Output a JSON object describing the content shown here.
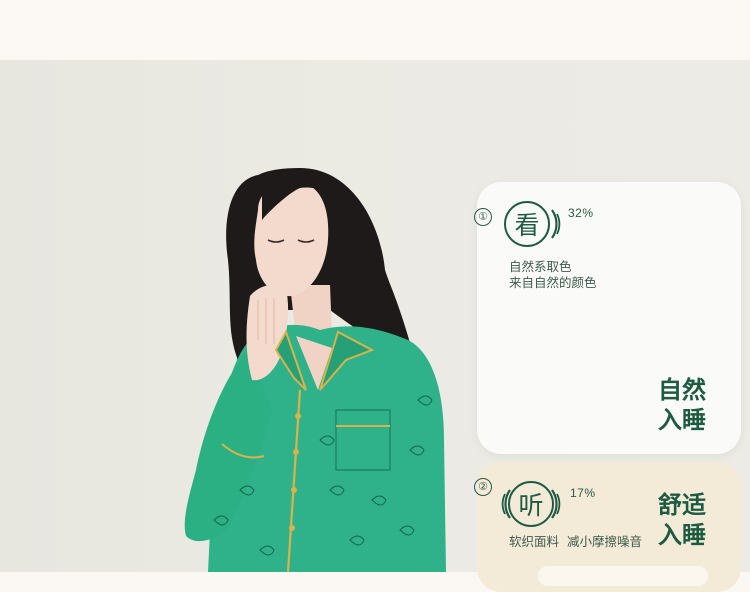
{
  "items": [
    {
      "number": "①",
      "badge_char": "看",
      "percent": "32%",
      "desc_line1": "自然系取色",
      "desc_line2": "来自自然的颜色",
      "title_line1": "自然",
      "title_line2": "入睡"
    },
    {
      "number": "②",
      "badge_char": "听",
      "percent": "17%",
      "desc_line1": "软织面料",
      "desc_line2": "减小摩擦噪音",
      "title_line1": "舒适",
      "title_line2": "入睡"
    }
  ],
  "colors": {
    "accent_green": "#1f5b44",
    "pajama_green": "#2fb28a",
    "card_1_bg": "#fafbf8",
    "card_2_bg": "#f4ead8"
  }
}
